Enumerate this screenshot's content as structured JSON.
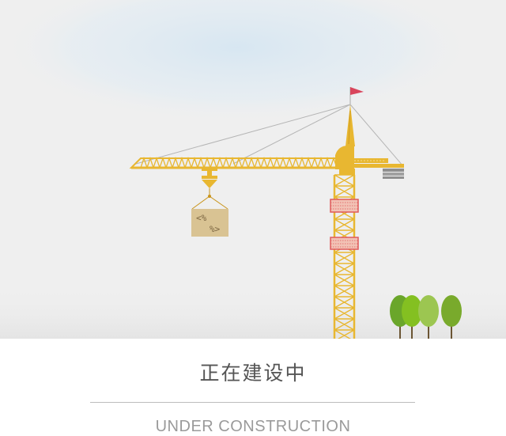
{
  "page": {
    "title": "正在建设中",
    "subtitle": "UNDER CONSTRUCTION"
  },
  "illustration": {
    "crate_lines": [
      "<%",
      "%>"
    ],
    "icons": [
      "crane-illustration",
      "flag-icon",
      "tree-icon"
    ]
  },
  "colors": {
    "crane": "#e8b731",
    "crane_dark": "#c9951c",
    "flag": "#d9455c",
    "cage": "#e05a5a",
    "crate": "#d9c393",
    "tree_dark": "#6aa62a",
    "tree_light": "#9cc651",
    "cable": "#b5b5b5",
    "counterweight": "#8f8f8f",
    "title_text": "#555555",
    "subtitle_text": "#9a9a9a"
  }
}
